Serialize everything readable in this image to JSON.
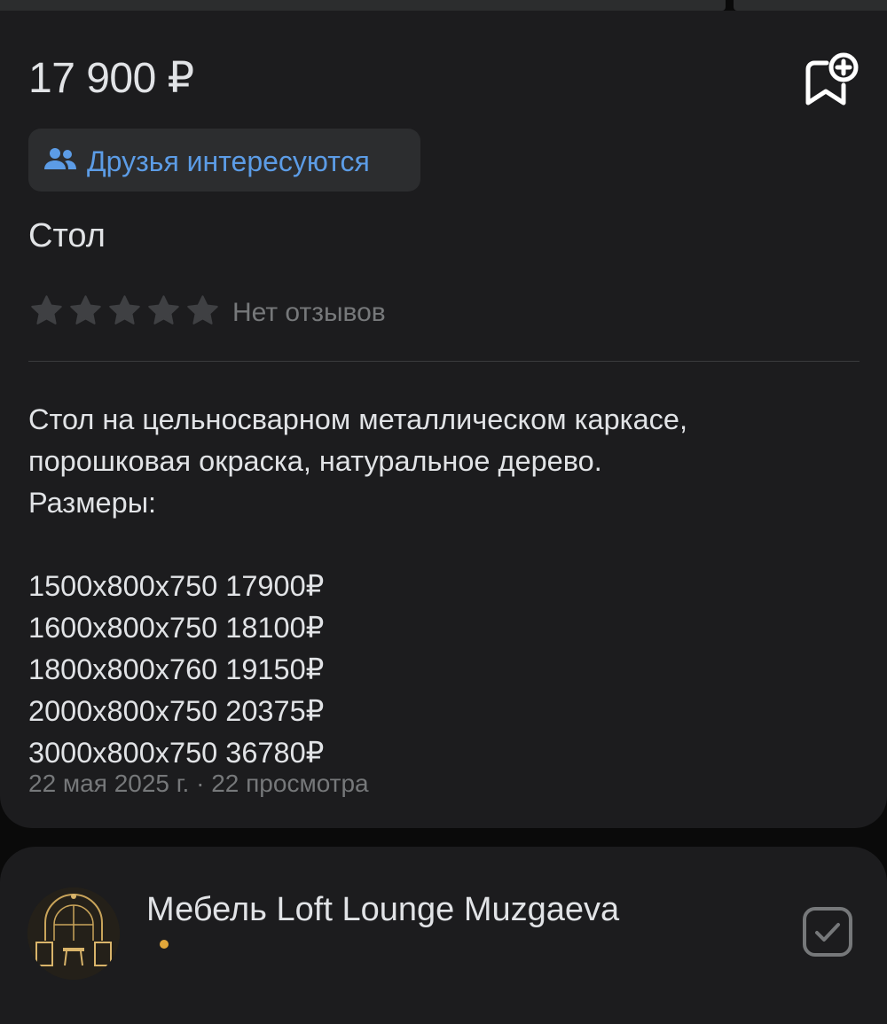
{
  "product": {
    "price": "17 900 ₽",
    "friends_chip": "Друзья интересуются",
    "title": "Стол",
    "rating_stars": 0,
    "reviews_text": "Нет отзывов",
    "description_lines": [
      "Стол на цельносварном металлическом каркасе,",
      "порошковая окраска, натуральное дерево.",
      "Размеры:",
      "",
      "1500х800х750 17900₽",
      "1600х800х750 18100₽",
      "1800х800х760 19150₽",
      "2000х800х750 20375₽",
      "3000х800х750 36780₽"
    ],
    "meta": "22 мая 2025 г. · 22 просмотра"
  },
  "seller": {
    "name": "Мебель Loft Lounge Muzgaeva"
  },
  "icons": {
    "bookmark": "bookmark-add-icon",
    "friends": "people-icon",
    "star": "star-icon",
    "subscribe": "check-square-icon"
  },
  "colors": {
    "background": "#0a0a0a",
    "card": "#1c1c1e",
    "accent": "#5c9ce6",
    "secondary_text": "#76787a",
    "star_empty": "#3f4043"
  }
}
